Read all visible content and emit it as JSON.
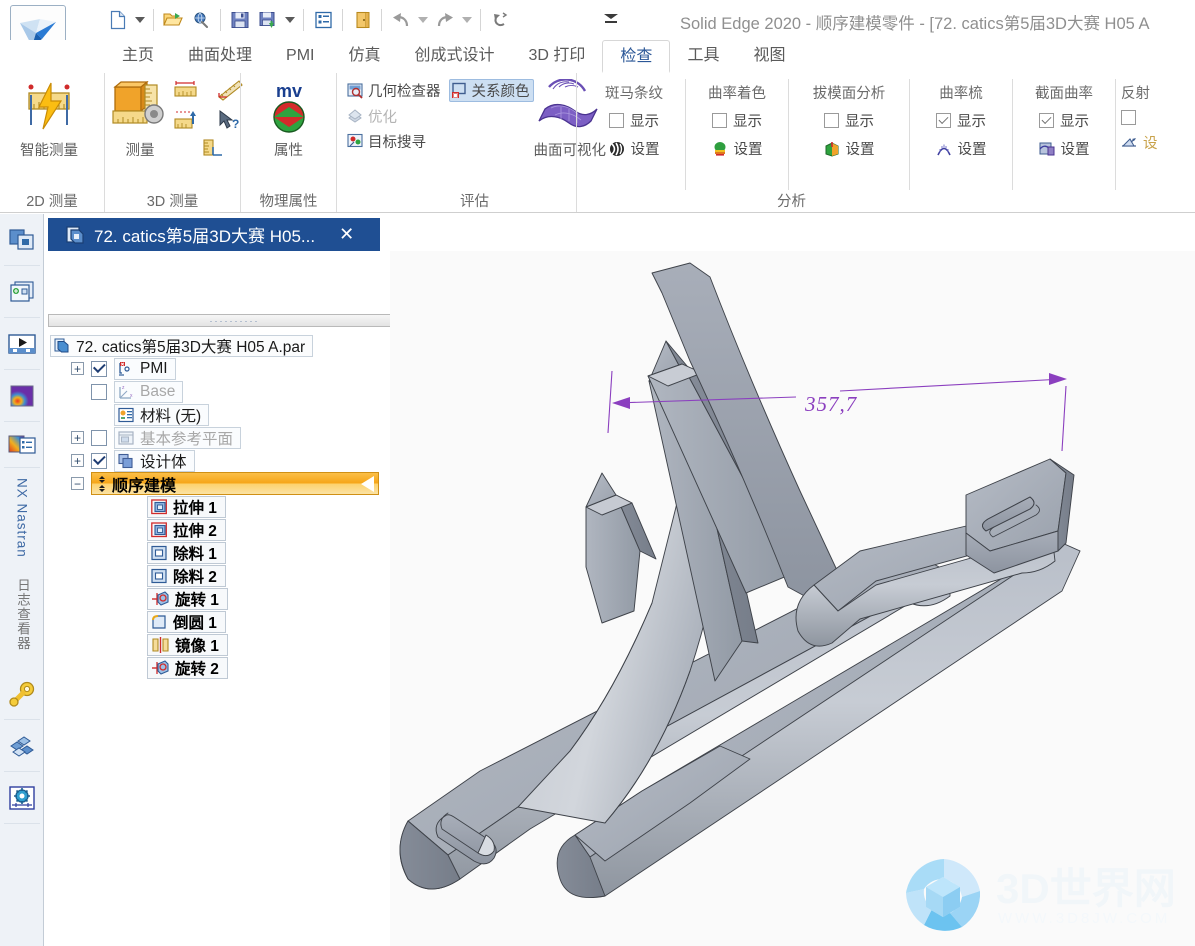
{
  "window": {
    "title": "Solid Edge 2020 - 顺序建模零件 - [72. catics第5届3D大赛 H05 A",
    "logo_icon": "solid-edge-logo"
  },
  "quick_access": {
    "items": [
      {
        "icon": "new-document-icon",
        "name": "new"
      },
      {
        "icon": "chevron-down-icon",
        "name": "new-dropdown"
      },
      {
        "icon": "open-folder-icon",
        "name": "open"
      },
      {
        "icon": "globe-icon",
        "name": "open-web"
      },
      {
        "icon": "save-icon",
        "name": "save"
      },
      {
        "icon": "save-as-icon",
        "name": "save-as"
      },
      {
        "icon": "chevron-down-icon",
        "name": "save-dropdown"
      },
      {
        "icon": "properties-list-icon",
        "name": "properties"
      },
      {
        "icon": "exit-door-icon",
        "name": "close"
      },
      {
        "icon": "undo-icon",
        "name": "undo"
      },
      {
        "icon": "chevron-down-icon",
        "name": "undo-dropdown"
      },
      {
        "icon": "redo-icon",
        "name": "redo"
      },
      {
        "icon": "chevron-down-icon",
        "name": "redo-dropdown"
      },
      {
        "icon": "repeat-icon",
        "name": "repeat"
      },
      {
        "icon": "customize-chevron-icon",
        "name": "customize-qat"
      }
    ]
  },
  "ribbon": {
    "tabs": [
      {
        "label": "主页",
        "active": false
      },
      {
        "label": "曲面处理",
        "active": false
      },
      {
        "label": "PMI",
        "active": false
      },
      {
        "label": "仿真",
        "active": false
      },
      {
        "label": "创成式设计",
        "active": false
      },
      {
        "label": "3D 打印",
        "active": false
      },
      {
        "label": "检查",
        "active": true
      },
      {
        "label": "工具",
        "active": false
      },
      {
        "label": "视图",
        "active": false
      }
    ],
    "groups": [
      {
        "title": "2D 测量",
        "name": "group-2d-measure",
        "big_buttons": [
          {
            "label": "智能测量",
            "icon": "smart-measure-icon"
          }
        ]
      },
      {
        "title": "3D 测量",
        "name": "group-3d-measure",
        "big_buttons": [
          {
            "label": "测量",
            "icon": "measure-icon"
          }
        ],
        "small_icons": [
          {
            "name": "measure-distance-icon"
          },
          {
            "name": "measure-angle-icon"
          },
          {
            "name": "measure-normal-icon"
          },
          {
            "name": "measure-query-icon"
          },
          {
            "name": "measure-area-icon"
          }
        ]
      },
      {
        "title": "物理属性",
        "name": "group-physical-properties",
        "big_buttons": [
          {
            "label": "属性",
            "icon": "mv-properties-icon"
          }
        ]
      },
      {
        "title": "评估",
        "name": "group-evaluate",
        "commands": [
          {
            "label": "几何检查器",
            "icon": "geometry-inspector-icon",
            "disabled": false,
            "highlighted": false
          },
          {
            "label": "关系颜色",
            "icon": "relationship-colors-icon",
            "disabled": false,
            "highlighted": true
          },
          {
            "label": "优化",
            "icon": "optimize-icon",
            "disabled": true,
            "highlighted": false
          },
          {
            "label": "目标搜寻",
            "icon": "goal-seek-icon",
            "disabled": false,
            "highlighted": false
          }
        ],
        "big_buttons": [
          {
            "label": "曲面可视化",
            "icon": "surface-visualization-icon"
          }
        ]
      },
      {
        "title": "分析",
        "name": "group-analysis",
        "columns": [
          {
            "header": "斑马条纹",
            "show_label": "显示",
            "checked": false,
            "settings_label": "设置",
            "settings_icon": "zebra-stripes-icon"
          },
          {
            "header": "曲率着色",
            "show_label": "显示",
            "checked": false,
            "settings_label": "设置",
            "settings_icon": "curvature-shading-icon"
          },
          {
            "header": "拔模面分析",
            "show_label": "显示",
            "checked": false,
            "settings_label": "设置",
            "settings_icon": "draft-analysis-icon"
          },
          {
            "header": "曲率梳",
            "show_label": "显示",
            "checked": true,
            "settings_label": "设置",
            "settings_icon": "curvature-comb-icon"
          },
          {
            "header": "截面曲率",
            "show_label": "显示",
            "checked": true,
            "settings_label": "设置",
            "settings_icon": "section-curvature-icon"
          },
          {
            "header": "反射",
            "show_label": "",
            "checked": false,
            "settings_label": "",
            "settings_icon": "reflection-icon"
          }
        ]
      }
    ]
  },
  "left_rail": {
    "items": [
      {
        "name": "path-finder-icon",
        "label": ""
      },
      {
        "name": "layers-icon",
        "label": ""
      },
      {
        "name": "animation-icon",
        "label": ""
      },
      {
        "name": "color-manager-icon",
        "label": ""
      },
      {
        "name": "nx-nastran-log-icon",
        "label": ""
      }
    ],
    "vertical_labels": [
      {
        "text": "NX Nastran",
        "color": "#3f6aa5"
      },
      {
        "text": "日志查看器",
        "color": "#7a7a7a"
      }
    ],
    "bottom_items": [
      {
        "name": "sensors-key-icon"
      },
      {
        "name": "features-library-icon"
      },
      {
        "name": "variables-gear-icon"
      }
    ]
  },
  "document_tab": {
    "label": "72. catics第5届3D大赛 H05...",
    "icon": "part-document-icon",
    "close_label": "✕"
  },
  "tree": {
    "grip_dots": "··········",
    "root": {
      "label": "72. catics第5届3D大赛 H05 A.par",
      "icon": "part-document-icon"
    },
    "nodes": [
      {
        "label": "PMI",
        "icon": "pmi-icon",
        "expander": "+",
        "checkbox": "checked",
        "dim": false
      },
      {
        "label": "Base",
        "icon": "base-coordinate-icon",
        "expander": "",
        "checkbox": "unchecked",
        "dim": true
      },
      {
        "label": "材料 (无)",
        "icon": "material-icon",
        "expander": "",
        "checkbox": "none",
        "dim": false
      },
      {
        "label": "基本参考平面",
        "icon": "reference-planes-icon",
        "expander": "+",
        "checkbox": "unchecked",
        "dim": true
      },
      {
        "label": "设计体",
        "icon": "design-body-icon",
        "expander": "+",
        "checkbox": "checked",
        "dim": false
      }
    ],
    "ordered_modeling": {
      "label": "顺序建模",
      "expander": "−",
      "icon": "drag-handle-icon",
      "marker": "play-back-triangle"
    },
    "features": [
      {
        "label": "拉伸 1",
        "icon": "extrude-icon"
      },
      {
        "label": "拉伸 2",
        "icon": "extrude-icon"
      },
      {
        "label": "除料 1",
        "icon": "cutout-icon"
      },
      {
        "label": "除料 2",
        "icon": "cutout-icon"
      },
      {
        "label": "旋转 1",
        "icon": "revolve-icon"
      },
      {
        "label": "倒圆 1",
        "icon": "round-icon"
      },
      {
        "label": "镜像 1",
        "icon": "mirror-icon"
      },
      {
        "label": "旋转 2",
        "icon": "revolve-icon"
      }
    ]
  },
  "viewport": {
    "dimension": {
      "value": "357,7",
      "color": "#8b3fbf"
    },
    "model_color": "#9aa0ab",
    "background": "#fafafa",
    "watermark": {
      "text": "3D世界网",
      "subtext": "WWW.3D8JW.COM"
    }
  }
}
